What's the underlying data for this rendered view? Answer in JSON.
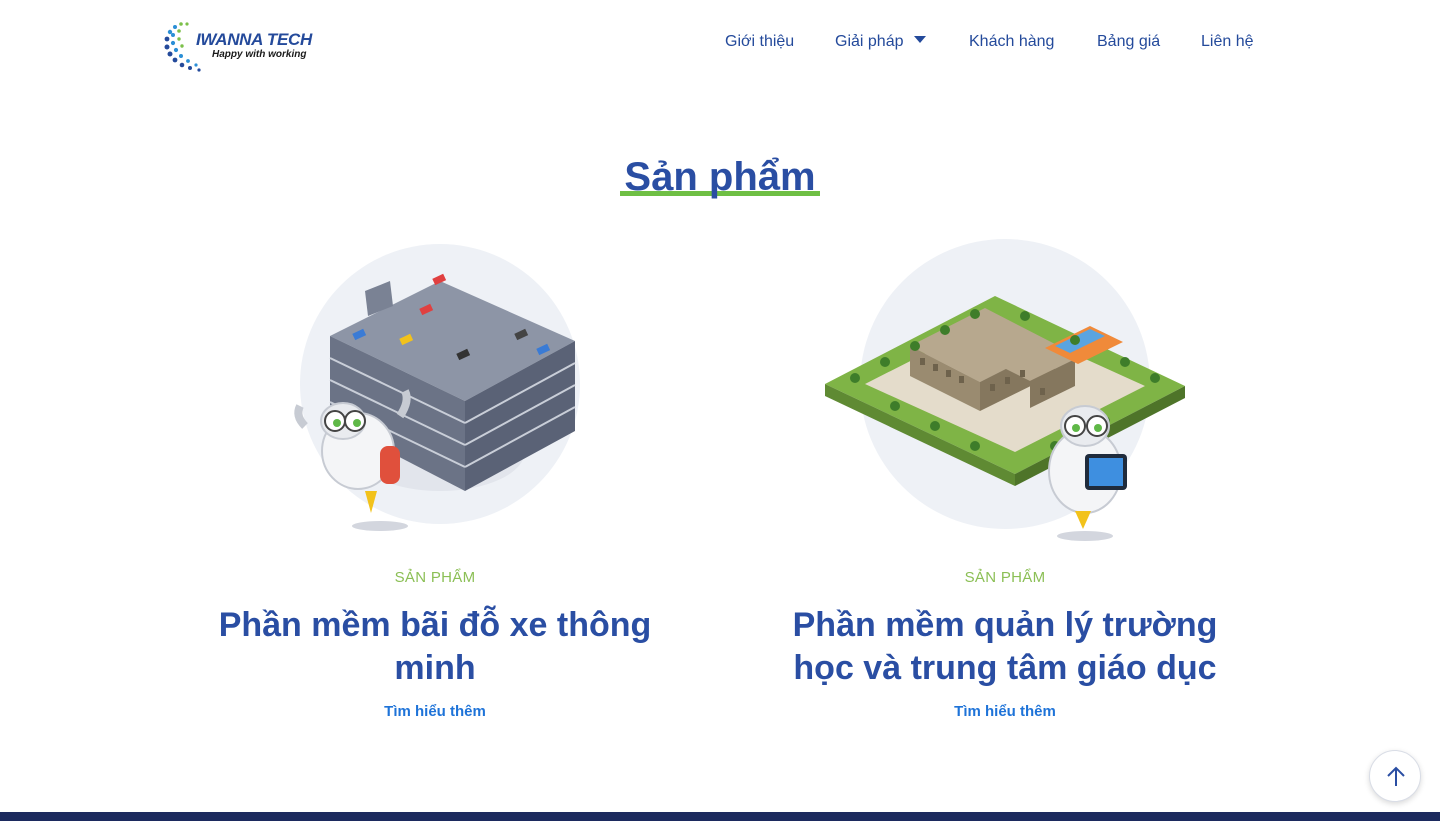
{
  "header": {
    "logo": {
      "brand": "IWANNA TECH",
      "tagline": "Happy with working"
    },
    "nav": [
      {
        "label": "Giới thiệu"
      },
      {
        "label": "Giải pháp",
        "has_dropdown": true
      },
      {
        "label": "Khách hàng"
      },
      {
        "label": "Bảng giá"
      },
      {
        "label": "Liên hệ"
      }
    ]
  },
  "products_section": {
    "title": "Sản phẩm",
    "cards": [
      {
        "eyebrow": "SẢN PHẨM",
        "title": "Phần mềm bãi đỗ xe thông minh",
        "link": "Tìm hiểu thêm",
        "illustration": "parking-garage-robot"
      },
      {
        "eyebrow": "SẢN PHẨM",
        "title": "Phần mềm quản lý trường học và trung tâm giáo dục",
        "link": "Tìm hiểu thêm",
        "illustration": "school-campus-robot"
      }
    ]
  },
  "colors": {
    "primary": "#2a4ea3",
    "accent_green": "#6fbf44",
    "eyebrow_green": "#8bbf55",
    "link_blue": "#1e73d8",
    "footer": "#1c2a5e"
  },
  "scroll_top_icon": "arrow-up-icon"
}
